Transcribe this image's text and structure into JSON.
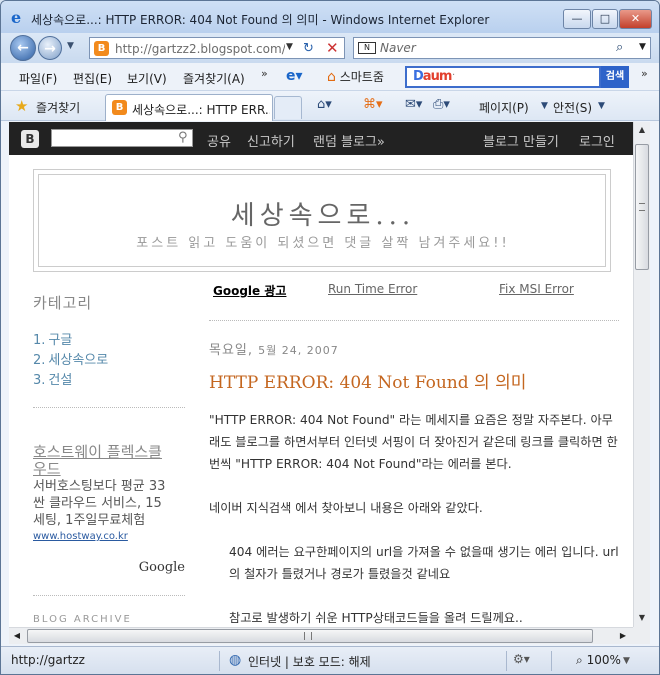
{
  "window": {
    "title": "세상속으로...: HTTP ERROR: 404 Not Found 의 의미 - Windows Internet Explorer",
    "min_label": "—",
    "max_label": "□",
    "close_label": "✕"
  },
  "address_bar": {
    "url": "http://gartzz2.blogspot.com/2",
    "search_placeholder": "Naver",
    "search_provider": "N"
  },
  "menu": {
    "items": [
      "파일(F)",
      "편집(E)",
      "보기(V)",
      "즐겨찾기(A)"
    ],
    "smart_label": "스마트줌",
    "daum_logo_a": "D",
    "daum_logo_b": "aum",
    "daum_search_label": "검색"
  },
  "favorites_bar": {
    "favorites_label": "즐겨찾기",
    "tab_label": "세상속으로...: HTTP ERR...",
    "page_label": "페이지(P)",
    "safety_label": "안전(S)"
  },
  "blogger_nav": {
    "logo": "B",
    "links": [
      "공유",
      "신고하기",
      "랜덤 블로그»",
      "블로그 만들기",
      "로그인"
    ]
  },
  "blog": {
    "title": "세상속으로...",
    "description": "포스트 읽고 도움이 되셨으면 댓글 살짝 남겨주세요!!"
  },
  "sidebar": {
    "category_heading": "카테고리",
    "categories": [
      {
        "num": "1.",
        "label": "구글"
      },
      {
        "num": "2.",
        "label": "세상속으로"
      },
      {
        "num": "3.",
        "label": "건설"
      }
    ],
    "ad": {
      "title": "호스트웨이 플렉스클",
      "title2": "우드",
      "line1": "서버호스팅보다 평균 33",
      "line2": "싼 클라우드 서비스, 15",
      "line3": "세팅, 1주일무료체험",
      "url": "www.hostway.co.kr"
    },
    "google_label": "Google",
    "archive_heading": "BLOG ARCHIVE"
  },
  "main": {
    "ad_links": [
      "Google 광고",
      "Run Time Error",
      "Fix MSI Error"
    ],
    "post_date_a": "목요일, ",
    "post_date_b": "5월 24, 2007",
    "post_title": "HTTP ERROR: 404 Not Found 의 의미",
    "para1": "\"HTTP ERROR: 404 Not Found\" 라는 메세지를 요즘은 정말 자주본다. 아무래도 블로그를 하면서부터 인터넷 서핑이 더 잦아진거 같은데 링크를 클릭하면 한번씩 \"HTTP ERROR: 404 Not Found\"라는 에러를 본다.",
    "para2": "네이버 지식검색 에서 찾아보니 내용은 아래와 같았다.",
    "quote1": "404 에러는 요구한페이지의 url을 가져올 수 없을때 생기는 에러 입니다. url의 철자가 틀렸거나 경로가 틀렸을것 같네요",
    "quote2": "참고로 발생하기 쉬운 HTTP상태코드들을 올려 드릴께요.."
  },
  "status": {
    "url": "http://gartzz",
    "zone": "인터넷 | 보호 모드: 해제",
    "zoom": "100%"
  }
}
